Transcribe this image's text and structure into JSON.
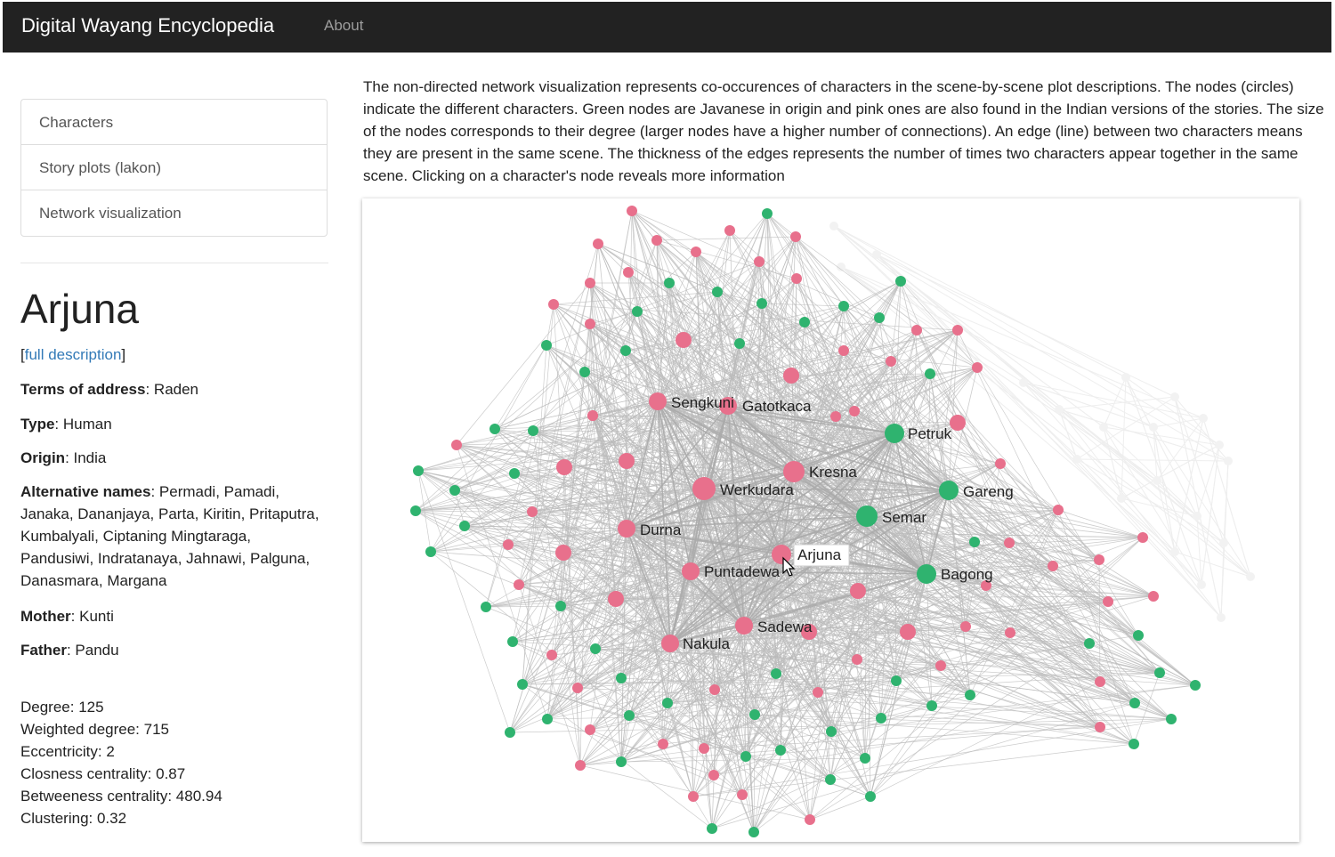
{
  "navbar": {
    "brand": "Digital Wayang Encyclopedia",
    "about": "About",
    "background": "#222222"
  },
  "sidebar": {
    "menu": [
      "Characters",
      "Story plots (lakon)",
      "Network visualization"
    ]
  },
  "character": {
    "name": "Arjuna",
    "full_description_link": "full description",
    "terms_of_address_label": "Terms of address",
    "terms_of_address": ": Raden",
    "type_label": "Type",
    "type": ": Human",
    "origin_label": "Origin",
    "origin": ": India",
    "alternative_names_label": "Alternative names",
    "alternative_names": ": Permadi, Pamadi, Janaka, Dananjaya, Parta, Kiritin, Pritaputra, Kumbalyali, Ciptaning Mingtaraga, Pandusiwi, Indratanaya, Jahnawi, Palguna, Danasmara, Margana",
    "mother_label": "Mother",
    "mother": ": Kunti",
    "father_label": "Father",
    "father": ": Pandu"
  },
  "stats": {
    "degree": "Degree: 125",
    "weighted_degree": "Weighted degree: 715",
    "eccentricity": "Eccentricity: 2",
    "closeness": "Closness centrality: 0.87",
    "betweenness": "Betweeness centrality: 480.94",
    "clustering": "Clustering: 0.32"
  },
  "description": "The non-directed network visualization represents co-occurences of characters in the scene-by-scene plot descriptions. The nodes (circles) indicate the different characters. Green nodes are Javanese in origin and pink ones are also found in the Indian versions of the stories. The size of the nodes corresponds to their degree (larger nodes have a higher number of connections). An edge (line) between two characters means they are present in the same scene. The thickness of the edges represents the number of times two characters appear together in the same scene. Clicking on a character's node reveals more information",
  "network": {
    "colors": {
      "javanese": "#2fb36f",
      "indian": "#e8708c",
      "edge": "#bbbbbb",
      "faded": "#eeeeee"
    },
    "selected": "Arjuna",
    "labeled_nodes": [
      {
        "name": "Sengkuni",
        "origin": "indian"
      },
      {
        "name": "Gatotkaca",
        "origin": "indian"
      },
      {
        "name": "Petruk",
        "origin": "javanese"
      },
      {
        "name": "Kresna",
        "origin": "indian"
      },
      {
        "name": "Werkudara",
        "origin": "indian"
      },
      {
        "name": "Gareng",
        "origin": "javanese"
      },
      {
        "name": "Semar",
        "origin": "javanese"
      },
      {
        "name": "Durna",
        "origin": "indian"
      },
      {
        "name": "Arjuna",
        "origin": "indian"
      },
      {
        "name": "Puntadewa",
        "origin": "indian"
      },
      {
        "name": "Bagong",
        "origin": "javanese"
      },
      {
        "name": "Sadewa",
        "origin": "indian"
      },
      {
        "name": "Nakula",
        "origin": "indian"
      }
    ]
  }
}
